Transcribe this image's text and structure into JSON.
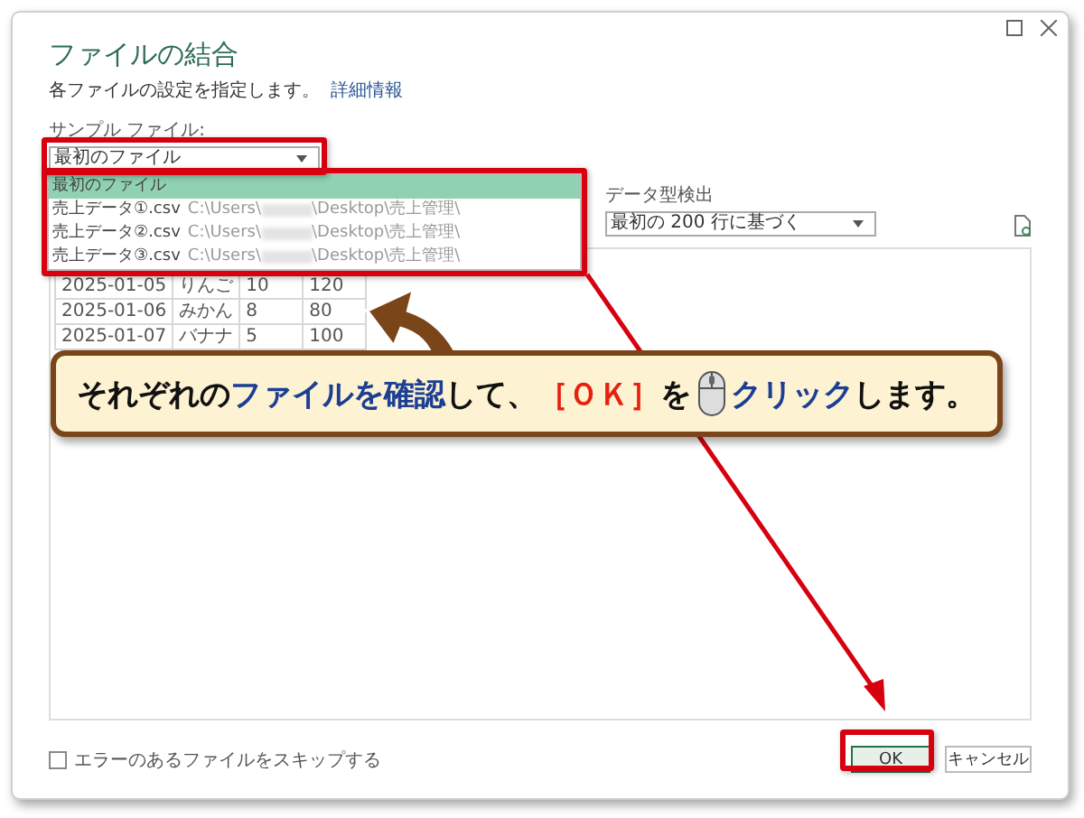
{
  "window": {
    "title": "ファイルの結合"
  },
  "description": {
    "text": "各ファイルの設定を指定します。",
    "link": "詳細情報"
  },
  "sample_file": {
    "label": "サンプル ファイル:",
    "value": "最初のファイル",
    "options": [
      {
        "name": "最初のファイル",
        "selected": true
      },
      {
        "name": "売上データ①.csv",
        "path_prefix": "C:\\Users\\",
        "path_suffix": "\\Desktop\\売上管理\\",
        "selected": false
      },
      {
        "name": "売上データ②.csv",
        "path_prefix": "C:\\Users\\",
        "path_suffix": "\\Desktop\\売上管理\\",
        "selected": false
      },
      {
        "name": "売上データ③.csv",
        "path_prefix": "C:\\Users\\",
        "path_suffix": "\\Desktop\\売上管理\\",
        "selected": false
      }
    ]
  },
  "type_detection": {
    "label": "データ型検出",
    "value": "最初の 200 行に基づく"
  },
  "preview": {
    "rows": [
      [
        "2025-01-05",
        "りんご",
        "10",
        "120"
      ],
      [
        "2025-01-06",
        "みかん",
        "8",
        "80"
      ],
      [
        "2025-01-07",
        "バナナ",
        "5",
        "100"
      ]
    ]
  },
  "skip_errors": {
    "label": "エラーのあるファイルをスキップする",
    "checked": false
  },
  "buttons": [
    {
      "label": "OK",
      "kind": "primary"
    },
    {
      "label": "キャンセル",
      "kind": "secondary"
    }
  ],
  "callout": {
    "before": [
      {
        "text": "それぞれの",
        "color": "#111111"
      },
      {
        "text": "ファイルを確認",
        "color": "#1c3f94"
      },
      {
        "text": "して、",
        "color": "#111111"
      },
      {
        "text": "［ＯＫ］",
        "color": "#e8200f"
      },
      {
        "text": "を",
        "color": "#111111"
      }
    ],
    "after": [
      {
        "text": "クリック",
        "color": "#1c3f94"
      },
      {
        "text": "します。",
        "color": "#111111"
      }
    ]
  }
}
